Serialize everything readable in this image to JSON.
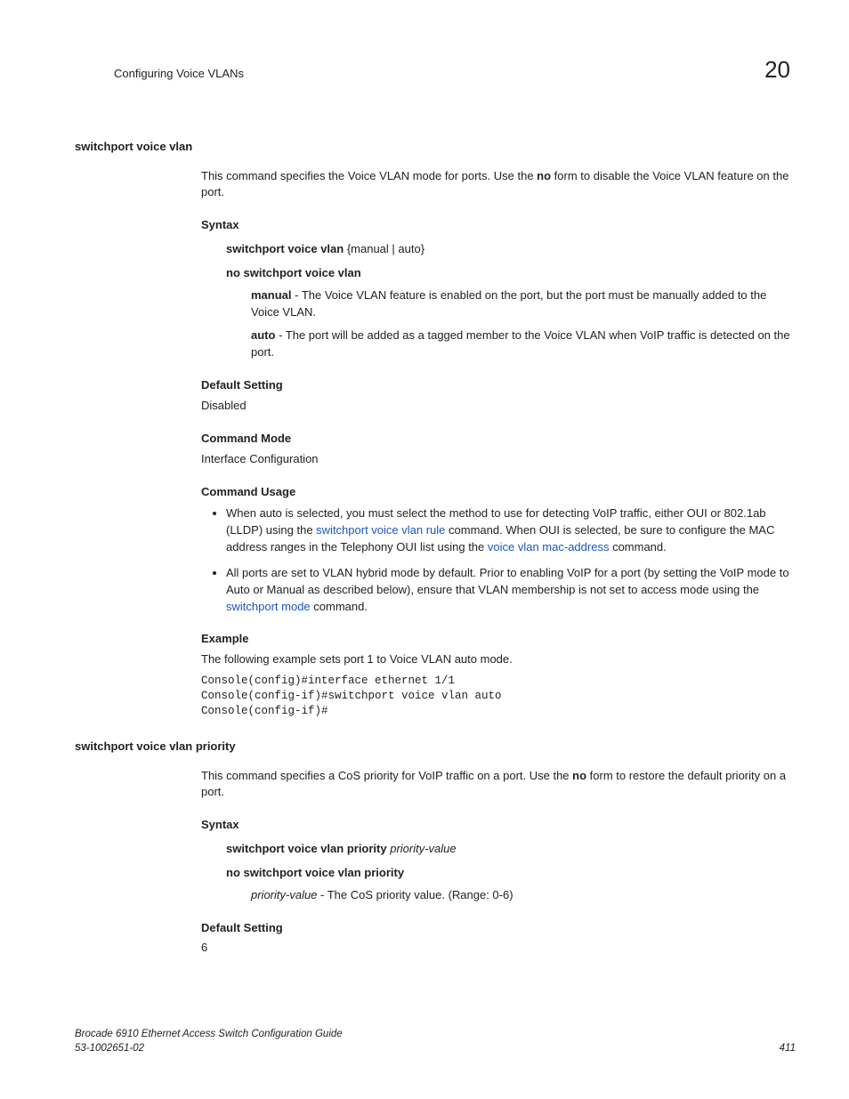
{
  "header": {
    "title": "Configuring Voice VLANs",
    "chapter": "20"
  },
  "cmd1": {
    "name": "switchport voice vlan",
    "desc1": "This command specifies the Voice VLAN mode for ports. Use the ",
    "desc_no": "no",
    "desc2": " form to disable the Voice VLAN feature on the port.",
    "syntax_label": "Syntax",
    "syntax_line": "switchport voice vlan",
    "syntax_args": " {manual | auto}",
    "no_syntax": "no switchport voice vlan",
    "param_manual_key": "manual",
    "param_manual_txt": " - The Voice VLAN feature is enabled on the port, but the port must be manually added to the Voice VLAN.",
    "param_auto_key": "auto",
    "param_auto_txt": " - The port will be added as a tagged member to the Voice VLAN when VoIP traffic is detected on the port.",
    "default_label": "Default Setting",
    "default_value": "Disabled",
    "mode_label": "Command Mode",
    "mode_value": "Interface Configuration",
    "usage_label": "Command Usage",
    "usage1_a": "When auto is selected, you must select the method to use for detecting VoIP traffic, either OUI or 802.1ab (LLDP) using the ",
    "usage1_link1": "switchport voice vlan rule",
    "usage1_b": " command. When OUI is selected, be sure to configure the MAC address ranges in the Telephony OUI list using the ",
    "usage1_link2": "voice vlan mac-address",
    "usage1_c": " command.",
    "usage2_a": "All ports are set to VLAN hybrid mode by default. Prior to enabling VoIP for a port (by setting the VoIP mode to Auto or Manual as described below), ensure that VLAN membership is not set to access mode using the ",
    "usage2_link": "switchport mode",
    "usage2_b": " command.",
    "example_label": "Example",
    "example_intro": "The following example sets port 1 to Voice VLAN auto mode.",
    "example_code": "Console(config)#interface ethernet 1/1\nConsole(config-if)#switchport voice vlan auto\nConsole(config-if)#"
  },
  "cmd2": {
    "name": "switchport voice vlan priority",
    "desc1": "This command specifies a CoS priority for VoIP traffic on a port. Use the ",
    "desc_no": "no",
    "desc2": " form to restore the default priority on a port.",
    "syntax_label": "Syntax",
    "syntax_line": "switchport voice vlan priority",
    "syntax_arg": " priority-value",
    "no_syntax": "no switchport voice vlan priority",
    "param_key": "priority-value",
    "param_txt": " - The CoS priority value. (Range: 0-6)",
    "default_label": "Default Setting",
    "default_value": "6"
  },
  "footer": {
    "line1": "Brocade 6910 Ethernet Access Switch Configuration Guide",
    "line2": "53-1002651-02",
    "page": "411"
  }
}
